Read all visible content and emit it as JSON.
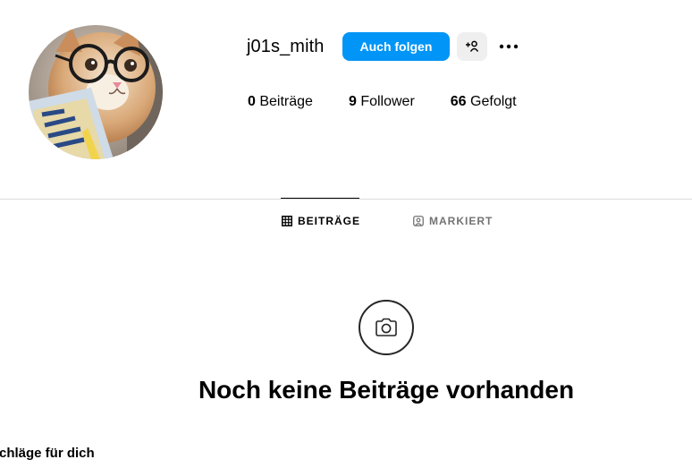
{
  "profile": {
    "username": "j01s_mith",
    "follow_label": "Auch folgen"
  },
  "stats": {
    "posts_count": "0",
    "posts_label": "Beiträge",
    "followers_count": "9",
    "followers_label": "Follower",
    "following_count": "66",
    "following_label": "Gefolgt"
  },
  "tabs": [
    {
      "label": "BEITRÄGE",
      "icon": "grid-icon",
      "active": true
    },
    {
      "label": "MARKIERT",
      "icon": "tagged-user-icon",
      "active": false
    }
  ],
  "empty_state": {
    "icon": "camera-icon",
    "title": "Noch keine Beiträge vorhanden"
  },
  "suggestions": {
    "label": "chläge für dich"
  },
  "colors": {
    "accent": "#0095f6",
    "secondary_button": "#efefef",
    "muted_text": "#737373",
    "divider": "#dbdbdb"
  }
}
